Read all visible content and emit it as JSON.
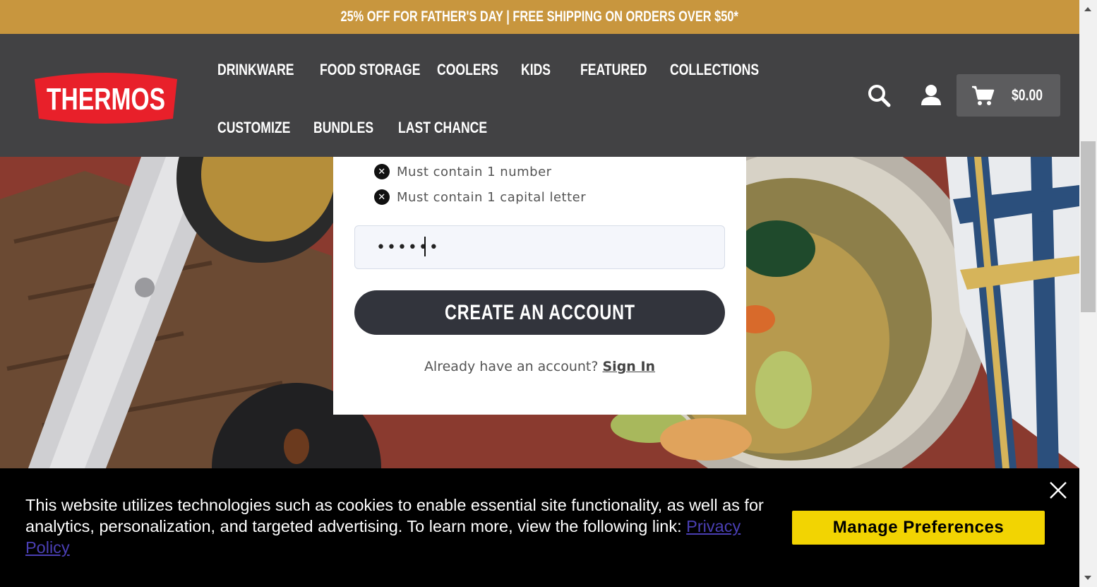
{
  "promo": {
    "text": "25% OFF FOR FATHER'S DAY | FREE SHIPPING ON ORDERS OVER $50*"
  },
  "header": {
    "logo_text": "THERMOS",
    "nav": [
      "DRINKWARE",
      "FOOD STORAGE",
      "COOLERS",
      "KIDS",
      "FEATURED",
      "COLLECTIONS",
      "CUSTOMIZE",
      "BUNDLES",
      "LAST CHANCE"
    ],
    "icons": [
      "search-icon",
      "account-icon",
      "cart-icon"
    ],
    "cart_total": "$0.00",
    "colors": {
      "promo_bg": "#c8963e",
      "header_bg": "#424244",
      "logo_red": "#e8202a"
    }
  },
  "form": {
    "rules": [
      "Must contain 1 number",
      "Must contain 1 capital letter"
    ],
    "password_value": "••••••",
    "create_button": "CREATE AN ACCOUNT",
    "signin_prompt": "Already have an account?",
    "signin_link": "Sign In"
  },
  "cookie": {
    "text": "This website utilizes technologies such as cookies to enable essential site functionality, as well as for analytics, personalization, and targeted advertising. To learn more, view the following link:",
    "link": "Privacy Policy",
    "button": "Manage Preferences",
    "colors": {
      "button_bg": "#f2d402",
      "link": "#4a3fb4"
    }
  }
}
